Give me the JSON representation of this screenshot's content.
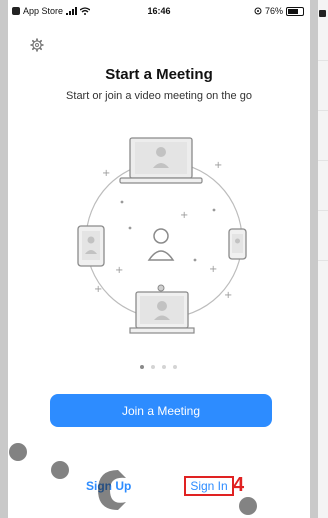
{
  "status_bar": {
    "carrier": "App Store",
    "time": "16:46",
    "battery": "76%"
  },
  "main": {
    "title": "Start a Meeting",
    "subtitle": "Start or join a video meeting on the go",
    "pager": {
      "total": 4,
      "active": 0
    }
  },
  "actions": {
    "join_label": "Join a Meeting",
    "signup_label": "Sign Up",
    "signin_label": "Sign In"
  },
  "annotation": {
    "step_number": "4",
    "color": "#e02222"
  },
  "colors": {
    "accent": "#2d8cff",
    "background": "#ffffff"
  },
  "icons": [
    "gear-icon",
    "laptop-icon",
    "tablet-icon",
    "phone-icon",
    "room-display-icon",
    "person-icon"
  ]
}
